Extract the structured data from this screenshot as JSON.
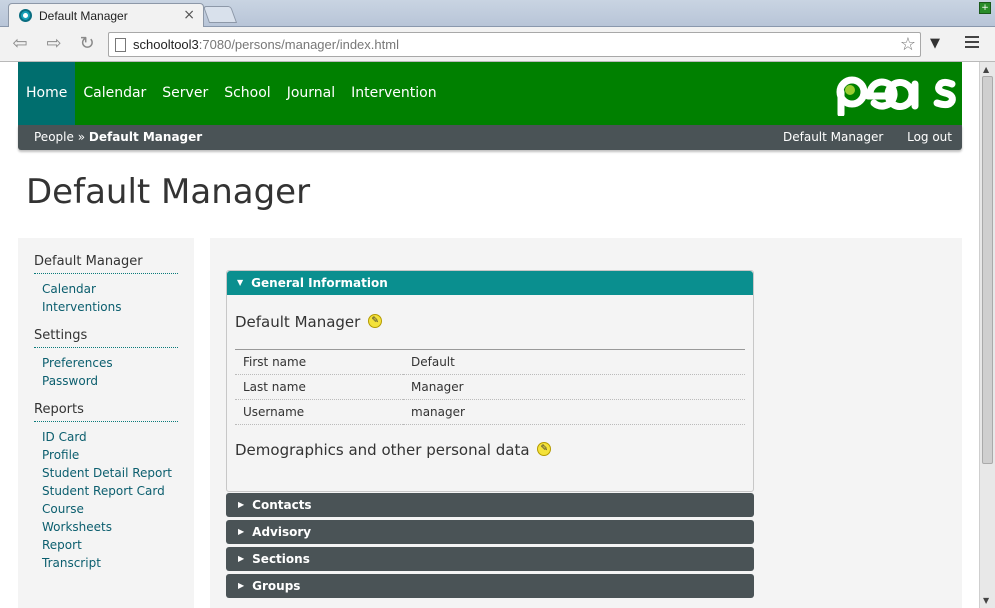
{
  "browser": {
    "tab_title": "Default Manager",
    "tab_close": "×",
    "url_host": "schooltool3",
    "url_path": ":7080/persons/manager/index.html"
  },
  "header": {
    "nav": [
      "Home",
      "Calendar",
      "Server",
      "School",
      "Journal",
      "Intervention"
    ],
    "logo_text": "Peas",
    "brand_color": "#008000",
    "active_color": "#006e6e"
  },
  "subbar": {
    "crumb_root": "People",
    "crumb_sep": "»",
    "crumb_current": "Default Manager",
    "user": "Default Manager",
    "logout": "Log out"
  },
  "page": {
    "title": "Default Manager"
  },
  "sidebar": {
    "groups": [
      {
        "heading": "Default Manager",
        "links": [
          "Calendar",
          "Interventions"
        ]
      },
      {
        "heading": "Settings",
        "links": [
          "Preferences",
          "Password"
        ]
      },
      {
        "heading": "Reports",
        "links": [
          "ID Card",
          "Profile",
          "Student Detail Report",
          "Student Report Card",
          "Course Worksheets Report",
          "Transcript"
        ]
      }
    ]
  },
  "general": {
    "header": "General Information",
    "name": "Default Manager",
    "rows": [
      {
        "label": "First name",
        "value": "Default"
      },
      {
        "label": "Last name",
        "value": "Manager"
      },
      {
        "label": "Username",
        "value": "manager"
      }
    ],
    "demographics": "Demographics and other personal data"
  },
  "sections": [
    "Contacts",
    "Advisory",
    "Sections",
    "Groups"
  ]
}
